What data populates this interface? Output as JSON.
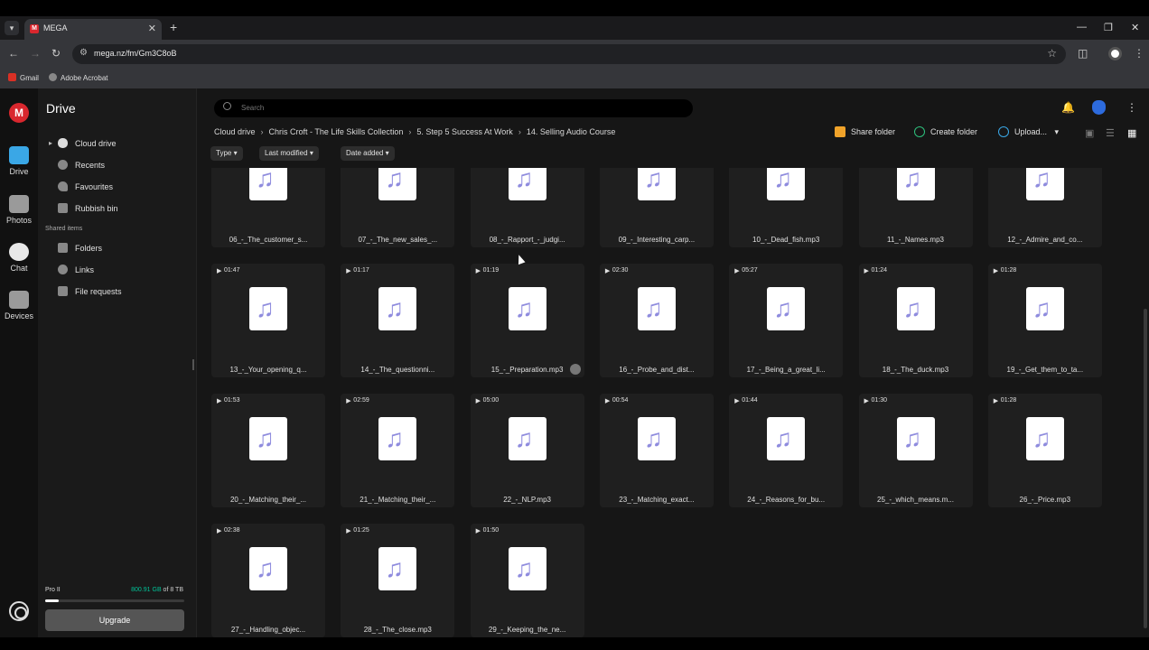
{
  "browser": {
    "tab_title": "MEGA",
    "tab_favicon": "M",
    "url": "mega.nz/fm/Gm3C8oB",
    "bookmarks": [
      "Gmail",
      "Adobe Acrobat"
    ]
  },
  "rail": {
    "logo": "M",
    "items": [
      "Drive",
      "Photos",
      "Chat",
      "Devices"
    ]
  },
  "sidebar": {
    "title": "Drive",
    "items": [
      "Cloud drive",
      "Recents",
      "Favourites",
      "Rubbish bin"
    ],
    "section_label": "Shared items",
    "shared_items": [
      "Folders",
      "Links",
      "File requests"
    ],
    "plan": "Pro II",
    "storage_used": "800.91 GB",
    "storage_total": " of 8 TB",
    "storage_fraction": 0.098,
    "upgrade_label": "Upgrade"
  },
  "toolbar": {
    "search_placeholder": "Search",
    "breadcrumbs": [
      "Cloud drive",
      "Chris Croft - The Life Skills Collection",
      "5. Step 5 Success At Work",
      "14. Selling Audio Course"
    ],
    "share_folder": "Share folder",
    "create_folder": "Create folder",
    "upload": "Upload...",
    "filters": [
      "Type",
      "Last modified",
      "Date added"
    ]
  },
  "files": [
    {
      "name": "06_-_The_customer_s...",
      "duration": ""
    },
    {
      "name": "07_-_The_new_sales_...",
      "duration": ""
    },
    {
      "name": "08_-_Rapport_-_judgi...",
      "duration": ""
    },
    {
      "name": "09_-_Interesting_carp...",
      "duration": ""
    },
    {
      "name": "10_-_Dead_fish.mp3",
      "duration": ""
    },
    {
      "name": "11_-_Names.mp3",
      "duration": ""
    },
    {
      "name": "12_-_Admire_and_co...",
      "duration": ""
    },
    {
      "name": "13_-_Your_opening_q...",
      "duration": "01:47"
    },
    {
      "name": "14_-_The_questionni...",
      "duration": "01:17"
    },
    {
      "name": "15_-_Preparation.mp3",
      "duration": "01:19"
    },
    {
      "name": "16_-_Probe_and_dist...",
      "duration": "02:30"
    },
    {
      "name": "17_-_Being_a_great_li...",
      "duration": "05:27"
    },
    {
      "name": "18_-_The_duck.mp3",
      "duration": "01:24"
    },
    {
      "name": "19_-_Get_them_to_ta...",
      "duration": "01:28"
    },
    {
      "name": "20_-_Matching_their_...",
      "duration": "01:53"
    },
    {
      "name": "21_-_Matching_their_...",
      "duration": "02:59"
    },
    {
      "name": "22_-_NLP.mp3",
      "duration": "05:00"
    },
    {
      "name": "23_-_Matching_exact...",
      "duration": "00:54"
    },
    {
      "name": "24_-_Reasons_for_bu...",
      "duration": "01:44"
    },
    {
      "name": "25_-_which_means.m...",
      "duration": "01:30"
    },
    {
      "name": "26_-_Price.mp3",
      "duration": "01:28"
    },
    {
      "name": "27_-_Handling_objec...",
      "duration": "02:38"
    },
    {
      "name": "28_-_The_close.mp3",
      "duration": "01:25"
    },
    {
      "name": "29_-_Keeping_the_ne...",
      "duration": "01:50"
    }
  ],
  "colors": {
    "brand": "#d9272e",
    "storage_used": "#00c398",
    "music_icon": "#8f8cde"
  }
}
